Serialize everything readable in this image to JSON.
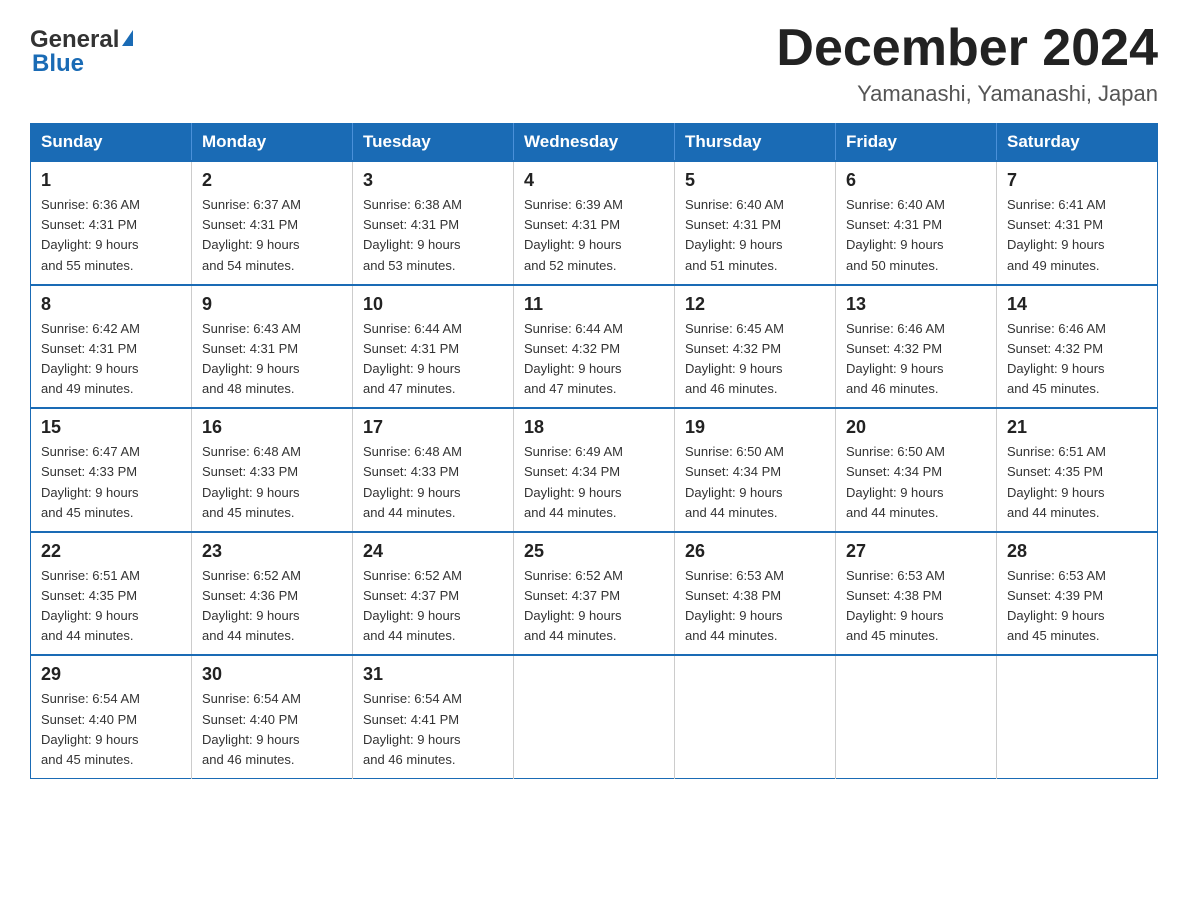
{
  "header": {
    "logo_general": "General",
    "logo_blue": "Blue",
    "title": "December 2024",
    "subtitle": "Yamanashi, Yamanashi, Japan"
  },
  "days_of_week": [
    "Sunday",
    "Monday",
    "Tuesday",
    "Wednesday",
    "Thursday",
    "Friday",
    "Saturday"
  ],
  "weeks": [
    [
      {
        "day": "1",
        "sunrise": "6:36 AM",
        "sunset": "4:31 PM",
        "daylight": "9 hours and 55 minutes."
      },
      {
        "day": "2",
        "sunrise": "6:37 AM",
        "sunset": "4:31 PM",
        "daylight": "9 hours and 54 minutes."
      },
      {
        "day": "3",
        "sunrise": "6:38 AM",
        "sunset": "4:31 PM",
        "daylight": "9 hours and 53 minutes."
      },
      {
        "day": "4",
        "sunrise": "6:39 AM",
        "sunset": "4:31 PM",
        "daylight": "9 hours and 52 minutes."
      },
      {
        "day": "5",
        "sunrise": "6:40 AM",
        "sunset": "4:31 PM",
        "daylight": "9 hours and 51 minutes."
      },
      {
        "day": "6",
        "sunrise": "6:40 AM",
        "sunset": "4:31 PM",
        "daylight": "9 hours and 50 minutes."
      },
      {
        "day": "7",
        "sunrise": "6:41 AM",
        "sunset": "4:31 PM",
        "daylight": "9 hours and 49 minutes."
      }
    ],
    [
      {
        "day": "8",
        "sunrise": "6:42 AM",
        "sunset": "4:31 PM",
        "daylight": "9 hours and 49 minutes."
      },
      {
        "day": "9",
        "sunrise": "6:43 AM",
        "sunset": "4:31 PM",
        "daylight": "9 hours and 48 minutes."
      },
      {
        "day": "10",
        "sunrise": "6:44 AM",
        "sunset": "4:31 PM",
        "daylight": "9 hours and 47 minutes."
      },
      {
        "day": "11",
        "sunrise": "6:44 AM",
        "sunset": "4:32 PM",
        "daylight": "9 hours and 47 minutes."
      },
      {
        "day": "12",
        "sunrise": "6:45 AM",
        "sunset": "4:32 PM",
        "daylight": "9 hours and 46 minutes."
      },
      {
        "day": "13",
        "sunrise": "6:46 AM",
        "sunset": "4:32 PM",
        "daylight": "9 hours and 46 minutes."
      },
      {
        "day": "14",
        "sunrise": "6:46 AM",
        "sunset": "4:32 PM",
        "daylight": "9 hours and 45 minutes."
      }
    ],
    [
      {
        "day": "15",
        "sunrise": "6:47 AM",
        "sunset": "4:33 PM",
        "daylight": "9 hours and 45 minutes."
      },
      {
        "day": "16",
        "sunrise": "6:48 AM",
        "sunset": "4:33 PM",
        "daylight": "9 hours and 45 minutes."
      },
      {
        "day": "17",
        "sunrise": "6:48 AM",
        "sunset": "4:33 PM",
        "daylight": "9 hours and 44 minutes."
      },
      {
        "day": "18",
        "sunrise": "6:49 AM",
        "sunset": "4:34 PM",
        "daylight": "9 hours and 44 minutes."
      },
      {
        "day": "19",
        "sunrise": "6:50 AM",
        "sunset": "4:34 PM",
        "daylight": "9 hours and 44 minutes."
      },
      {
        "day": "20",
        "sunrise": "6:50 AM",
        "sunset": "4:34 PM",
        "daylight": "9 hours and 44 minutes."
      },
      {
        "day": "21",
        "sunrise": "6:51 AM",
        "sunset": "4:35 PM",
        "daylight": "9 hours and 44 minutes."
      }
    ],
    [
      {
        "day": "22",
        "sunrise": "6:51 AM",
        "sunset": "4:35 PM",
        "daylight": "9 hours and 44 minutes."
      },
      {
        "day": "23",
        "sunrise": "6:52 AM",
        "sunset": "4:36 PM",
        "daylight": "9 hours and 44 minutes."
      },
      {
        "day": "24",
        "sunrise": "6:52 AM",
        "sunset": "4:37 PM",
        "daylight": "9 hours and 44 minutes."
      },
      {
        "day": "25",
        "sunrise": "6:52 AM",
        "sunset": "4:37 PM",
        "daylight": "9 hours and 44 minutes."
      },
      {
        "day": "26",
        "sunrise": "6:53 AM",
        "sunset": "4:38 PM",
        "daylight": "9 hours and 44 minutes."
      },
      {
        "day": "27",
        "sunrise": "6:53 AM",
        "sunset": "4:38 PM",
        "daylight": "9 hours and 45 minutes."
      },
      {
        "day": "28",
        "sunrise": "6:53 AM",
        "sunset": "4:39 PM",
        "daylight": "9 hours and 45 minutes."
      }
    ],
    [
      {
        "day": "29",
        "sunrise": "6:54 AM",
        "sunset": "4:40 PM",
        "daylight": "9 hours and 45 minutes."
      },
      {
        "day": "30",
        "sunrise": "6:54 AM",
        "sunset": "4:40 PM",
        "daylight": "9 hours and 46 minutes."
      },
      {
        "day": "31",
        "sunrise": "6:54 AM",
        "sunset": "4:41 PM",
        "daylight": "9 hours and 46 minutes."
      },
      null,
      null,
      null,
      null
    ]
  ],
  "labels": {
    "sunrise": "Sunrise:",
    "sunset": "Sunset:",
    "daylight": "Daylight:"
  }
}
